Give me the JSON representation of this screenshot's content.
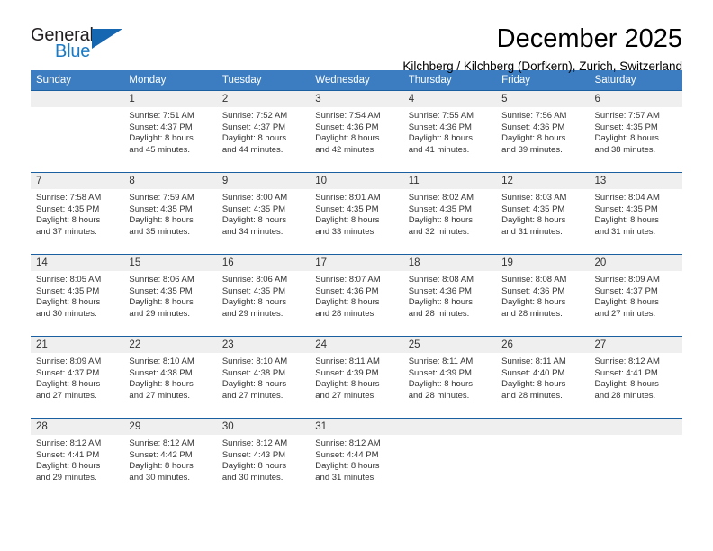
{
  "brand": {
    "name_top": "General",
    "name_bottom": "Blue",
    "color_dark": "#231f20",
    "color_blue": "#1a7ac4",
    "triangle_icon": "blue-triangle-icon"
  },
  "header": {
    "month_title": "December 2025",
    "location": "Kilchberg / Kilchberg (Dorfkern), Zurich, Switzerland"
  },
  "theme": {
    "header_bg": "#3b7dc0",
    "header_text": "#ffffff",
    "daynum_band_bg": "#efefef",
    "row_border": "#1a5fa0",
    "body_text": "#333333"
  },
  "weekdays": [
    "Sunday",
    "Monday",
    "Tuesday",
    "Wednesday",
    "Thursday",
    "Friday",
    "Saturday"
  ],
  "weeks": [
    [
      {
        "day": "",
        "sunrise": "",
        "sunset": "",
        "daylight_line1": "",
        "daylight_line2": ""
      },
      {
        "day": "1",
        "sunrise": "Sunrise: 7:51 AM",
        "sunset": "Sunset: 4:37 PM",
        "daylight_line1": "Daylight: 8 hours",
        "daylight_line2": "and 45 minutes."
      },
      {
        "day": "2",
        "sunrise": "Sunrise: 7:52 AM",
        "sunset": "Sunset: 4:37 PM",
        "daylight_line1": "Daylight: 8 hours",
        "daylight_line2": "and 44 minutes."
      },
      {
        "day": "3",
        "sunrise": "Sunrise: 7:54 AM",
        "sunset": "Sunset: 4:36 PM",
        "daylight_line1": "Daylight: 8 hours",
        "daylight_line2": "and 42 minutes."
      },
      {
        "day": "4",
        "sunrise": "Sunrise: 7:55 AM",
        "sunset": "Sunset: 4:36 PM",
        "daylight_line1": "Daylight: 8 hours",
        "daylight_line2": "and 41 minutes."
      },
      {
        "day": "5",
        "sunrise": "Sunrise: 7:56 AM",
        "sunset": "Sunset: 4:36 PM",
        "daylight_line1": "Daylight: 8 hours",
        "daylight_line2": "and 39 minutes."
      },
      {
        "day": "6",
        "sunrise": "Sunrise: 7:57 AM",
        "sunset": "Sunset: 4:35 PM",
        "daylight_line1": "Daylight: 8 hours",
        "daylight_line2": "and 38 minutes."
      }
    ],
    [
      {
        "day": "7",
        "sunrise": "Sunrise: 7:58 AM",
        "sunset": "Sunset: 4:35 PM",
        "daylight_line1": "Daylight: 8 hours",
        "daylight_line2": "and 37 minutes."
      },
      {
        "day": "8",
        "sunrise": "Sunrise: 7:59 AM",
        "sunset": "Sunset: 4:35 PM",
        "daylight_line1": "Daylight: 8 hours",
        "daylight_line2": "and 35 minutes."
      },
      {
        "day": "9",
        "sunrise": "Sunrise: 8:00 AM",
        "sunset": "Sunset: 4:35 PM",
        "daylight_line1": "Daylight: 8 hours",
        "daylight_line2": "and 34 minutes."
      },
      {
        "day": "10",
        "sunrise": "Sunrise: 8:01 AM",
        "sunset": "Sunset: 4:35 PM",
        "daylight_line1": "Daylight: 8 hours",
        "daylight_line2": "and 33 minutes."
      },
      {
        "day": "11",
        "sunrise": "Sunrise: 8:02 AM",
        "sunset": "Sunset: 4:35 PM",
        "daylight_line1": "Daylight: 8 hours",
        "daylight_line2": "and 32 minutes."
      },
      {
        "day": "12",
        "sunrise": "Sunrise: 8:03 AM",
        "sunset": "Sunset: 4:35 PM",
        "daylight_line1": "Daylight: 8 hours",
        "daylight_line2": "and 31 minutes."
      },
      {
        "day": "13",
        "sunrise": "Sunrise: 8:04 AM",
        "sunset": "Sunset: 4:35 PM",
        "daylight_line1": "Daylight: 8 hours",
        "daylight_line2": "and 31 minutes."
      }
    ],
    [
      {
        "day": "14",
        "sunrise": "Sunrise: 8:05 AM",
        "sunset": "Sunset: 4:35 PM",
        "daylight_line1": "Daylight: 8 hours",
        "daylight_line2": "and 30 minutes."
      },
      {
        "day": "15",
        "sunrise": "Sunrise: 8:06 AM",
        "sunset": "Sunset: 4:35 PM",
        "daylight_line1": "Daylight: 8 hours",
        "daylight_line2": "and 29 minutes."
      },
      {
        "day": "16",
        "sunrise": "Sunrise: 8:06 AM",
        "sunset": "Sunset: 4:35 PM",
        "daylight_line1": "Daylight: 8 hours",
        "daylight_line2": "and 29 minutes."
      },
      {
        "day": "17",
        "sunrise": "Sunrise: 8:07 AM",
        "sunset": "Sunset: 4:36 PM",
        "daylight_line1": "Daylight: 8 hours",
        "daylight_line2": "and 28 minutes."
      },
      {
        "day": "18",
        "sunrise": "Sunrise: 8:08 AM",
        "sunset": "Sunset: 4:36 PM",
        "daylight_line1": "Daylight: 8 hours",
        "daylight_line2": "and 28 minutes."
      },
      {
        "day": "19",
        "sunrise": "Sunrise: 8:08 AM",
        "sunset": "Sunset: 4:36 PM",
        "daylight_line1": "Daylight: 8 hours",
        "daylight_line2": "and 28 minutes."
      },
      {
        "day": "20",
        "sunrise": "Sunrise: 8:09 AM",
        "sunset": "Sunset: 4:37 PM",
        "daylight_line1": "Daylight: 8 hours",
        "daylight_line2": "and 27 minutes."
      }
    ],
    [
      {
        "day": "21",
        "sunrise": "Sunrise: 8:09 AM",
        "sunset": "Sunset: 4:37 PM",
        "daylight_line1": "Daylight: 8 hours",
        "daylight_line2": "and 27 minutes."
      },
      {
        "day": "22",
        "sunrise": "Sunrise: 8:10 AM",
        "sunset": "Sunset: 4:38 PM",
        "daylight_line1": "Daylight: 8 hours",
        "daylight_line2": "and 27 minutes."
      },
      {
        "day": "23",
        "sunrise": "Sunrise: 8:10 AM",
        "sunset": "Sunset: 4:38 PM",
        "daylight_line1": "Daylight: 8 hours",
        "daylight_line2": "and 27 minutes."
      },
      {
        "day": "24",
        "sunrise": "Sunrise: 8:11 AM",
        "sunset": "Sunset: 4:39 PM",
        "daylight_line1": "Daylight: 8 hours",
        "daylight_line2": "and 27 minutes."
      },
      {
        "day": "25",
        "sunrise": "Sunrise: 8:11 AM",
        "sunset": "Sunset: 4:39 PM",
        "daylight_line1": "Daylight: 8 hours",
        "daylight_line2": "and 28 minutes."
      },
      {
        "day": "26",
        "sunrise": "Sunrise: 8:11 AM",
        "sunset": "Sunset: 4:40 PM",
        "daylight_line1": "Daylight: 8 hours",
        "daylight_line2": "and 28 minutes."
      },
      {
        "day": "27",
        "sunrise": "Sunrise: 8:12 AM",
        "sunset": "Sunset: 4:41 PM",
        "daylight_line1": "Daylight: 8 hours",
        "daylight_line2": "and 28 minutes."
      }
    ],
    [
      {
        "day": "28",
        "sunrise": "Sunrise: 8:12 AM",
        "sunset": "Sunset: 4:41 PM",
        "daylight_line1": "Daylight: 8 hours",
        "daylight_line2": "and 29 minutes."
      },
      {
        "day": "29",
        "sunrise": "Sunrise: 8:12 AM",
        "sunset": "Sunset: 4:42 PM",
        "daylight_line1": "Daylight: 8 hours",
        "daylight_line2": "and 30 minutes."
      },
      {
        "day": "30",
        "sunrise": "Sunrise: 8:12 AM",
        "sunset": "Sunset: 4:43 PM",
        "daylight_line1": "Daylight: 8 hours",
        "daylight_line2": "and 30 minutes."
      },
      {
        "day": "31",
        "sunrise": "Sunrise: 8:12 AM",
        "sunset": "Sunset: 4:44 PM",
        "daylight_line1": "Daylight: 8 hours",
        "daylight_line2": "and 31 minutes."
      },
      {
        "day": "",
        "sunrise": "",
        "sunset": "",
        "daylight_line1": "",
        "daylight_line2": ""
      },
      {
        "day": "",
        "sunrise": "",
        "sunset": "",
        "daylight_line1": "",
        "daylight_line2": ""
      },
      {
        "day": "",
        "sunrise": "",
        "sunset": "",
        "daylight_line1": "",
        "daylight_line2": ""
      }
    ]
  ]
}
